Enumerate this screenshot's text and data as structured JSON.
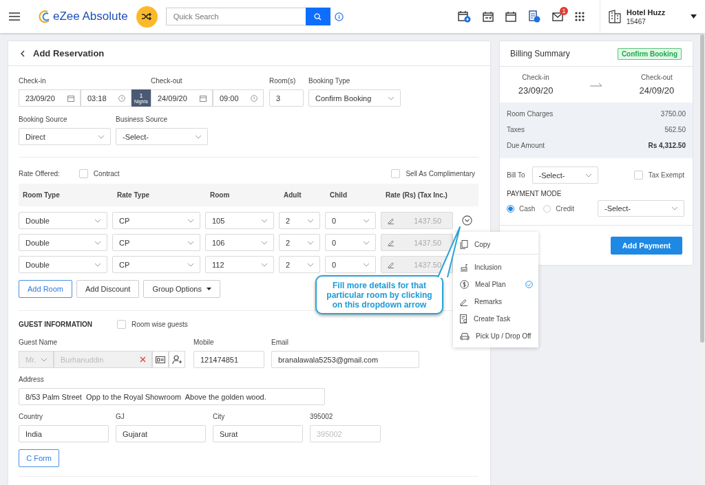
{
  "header": {
    "app_name": "eZee Absolute",
    "search": {
      "placeholder": "Quick Search"
    },
    "mail_badge": "1",
    "hotel": {
      "name": "Hotel Huzz",
      "code": "15467"
    }
  },
  "reservation": {
    "title": "Add Reservation",
    "stay": {
      "checkin_label": "Check-in",
      "checkin_date": "23/09/20",
      "checkin_time": "03:18",
      "nights": "1",
      "nights_label": "Nights",
      "checkout_label": "Check-out",
      "checkout_date": "24/09/20",
      "checkout_time": "09:00",
      "rooms_label": "Room(s)",
      "rooms": "3",
      "booking_type_label": "Booking Type",
      "booking_type": "Confirm Booking"
    },
    "sources": [
      {
        "label": "Booking Source",
        "value": "Direct"
      },
      {
        "label": "Business Source",
        "value": "-Select-"
      }
    ],
    "rate_offered_label": "Rate Offered:",
    "contract": {
      "label": "Contract",
      "checked": false
    },
    "complimentary": {
      "label": "Sell As Complimentary",
      "checked": false
    },
    "columns": [
      "Room Type",
      "Rate Type",
      "Room",
      "Adult",
      "Child",
      "Rate (Rs)  (Tax Inc.)"
    ],
    "rows": [
      {
        "room_type": "Double",
        "rate_type": "CP",
        "room": "105",
        "adult": "2",
        "child": "0",
        "rate": "1437.50",
        "menu_open": true
      },
      {
        "room_type": "Double",
        "rate_type": "CP",
        "room": "106",
        "adult": "2",
        "child": "0",
        "rate": "1437.50"
      },
      {
        "room_type": "Double",
        "rate_type": "CP",
        "room": "112",
        "adult": "2",
        "child": "0",
        "rate": "1437.50"
      }
    ],
    "buttons": [
      {
        "label": "Add Room",
        "kind": "primary"
      },
      {
        "label": "Add Discount",
        "kind": "plain"
      },
      {
        "label": "Group Options",
        "kind": "dropdown"
      }
    ],
    "guest": {
      "title": "GUEST INFORMATION",
      "room_wise": {
        "label": "Room wise guests",
        "checked": false
      },
      "name_label": "Guest Name",
      "salutation": "Mr.",
      "name": "Burhanuddin",
      "disabled": true,
      "mobile_label": "Mobile",
      "mobile": "121474851",
      "email_label": "Email",
      "email": "branalawala5253@gmail.com",
      "address_label": "Address",
      "address": "8/53 Palm Street  Opp to the Royal Showroom  Above the golden wood.",
      "location": [
        {
          "label": "Country",
          "value": "India",
          "disabled": false
        },
        {
          "label": "GJ",
          "value": "Gujarat",
          "disabled": false
        },
        {
          "label": "City",
          "value": "Surat",
          "disabled": false
        },
        {
          "label": "395002",
          "value": "395002",
          "disabled": true
        }
      ],
      "cform": "C Form"
    },
    "row_menu": [
      {
        "label": "Copy",
        "kind": "copy",
        "checked": false,
        "divider_after": true
      },
      {
        "label": "Inclusion",
        "kind": "inclusion",
        "checked": false,
        "divider_after": false
      },
      {
        "label": "Meal Plan",
        "kind": "meal",
        "checked": true,
        "divider_after": false
      },
      {
        "label": "Remarks",
        "kind": "remarks",
        "checked": false,
        "divider_after": false
      },
      {
        "label": "Create Task",
        "kind": "task",
        "checked": false,
        "divider_after": false
      },
      {
        "label": "Pick Up / Drop Off",
        "kind": "transport",
        "checked": false,
        "divider_after": false
      }
    ],
    "callout": "Fill more details for that particular room by clicking on this dropdown arrow"
  },
  "billing": {
    "title": "Billing Summary",
    "status": "Confirm Booking",
    "checkin_label": "Check-in",
    "checkin": "23/09/20",
    "checkout_label": "Check-out",
    "checkout": "24/09/20",
    "charges": [
      {
        "label": "Room Charges",
        "value": "3750.00",
        "bold": false
      },
      {
        "label": "Taxes",
        "value": "562.50",
        "bold": false
      },
      {
        "label": "Due Amount",
        "value": "Rs 4,312.50",
        "bold": true
      }
    ],
    "bill_to_label": "Bill To",
    "bill_to": "-Select-",
    "tax_exempt": {
      "label": "Tax Exempt",
      "checked": false
    },
    "payment_mode_label": "PAYMENT MODE",
    "modes": [
      {
        "label": "Cash",
        "selected": true
      },
      {
        "label": "Credit",
        "selected": false
      }
    ],
    "mode_select": "-Select-",
    "add_payment": "Add Payment"
  }
}
